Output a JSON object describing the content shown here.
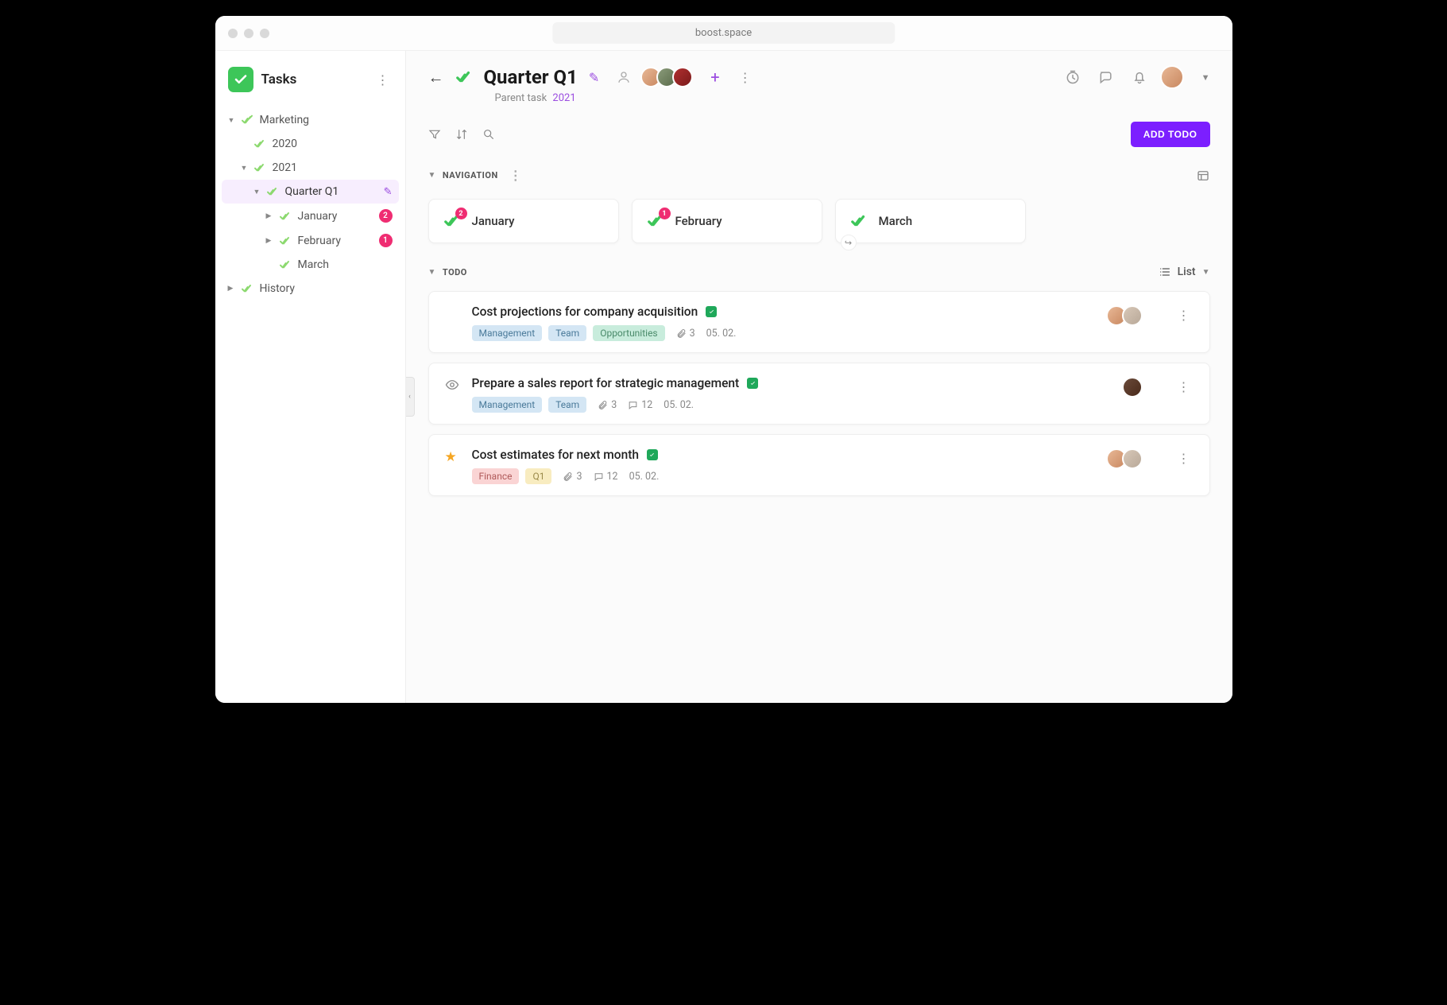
{
  "browser": {
    "url": "boost.space"
  },
  "sidebar": {
    "title": "Tasks",
    "tree": {
      "marketing": "Marketing",
      "y2020": "2020",
      "y2021": "2021",
      "quarter": "Quarter Q1",
      "months": [
        {
          "label": "January",
          "badge": "2"
        },
        {
          "label": "February",
          "badge": "1"
        },
        {
          "label": "March",
          "badge": ""
        }
      ],
      "history": "History"
    }
  },
  "header": {
    "title": "Quarter Q1",
    "breadcrumb_label": "Parent task",
    "breadcrumb_link": "2021",
    "add_todo": "ADD TODO"
  },
  "sections": {
    "navigation": "NAVIGATION",
    "todo": "TODO",
    "view_mode": "List"
  },
  "nav_cards": [
    {
      "label": "January",
      "badge": "2"
    },
    {
      "label": "February",
      "badge": "1"
    },
    {
      "label": "March",
      "badge": ""
    }
  ],
  "todos": [
    {
      "title": "Cost projections for company acquisition",
      "tags": [
        {
          "text": "Management",
          "cls": "tag-blue"
        },
        {
          "text": "Team",
          "cls": "tag-blue"
        },
        {
          "text": "Opportunities",
          "cls": "tag-teal"
        }
      ],
      "attachments": "3",
      "comments": "",
      "date": "05. 02.",
      "starred": false,
      "eye": false,
      "avatars": [
        "av1",
        "av5"
      ]
    },
    {
      "title": "Prepare a sales report for strategic management",
      "tags": [
        {
          "text": "Management",
          "cls": "tag-blue"
        },
        {
          "text": "Team",
          "cls": "tag-blue"
        }
      ],
      "attachments": "3",
      "comments": "12",
      "date": "05. 02.",
      "starred": false,
      "eye": true,
      "avatars": [
        "av4"
      ]
    },
    {
      "title": "Cost estimates for next month",
      "tags": [
        {
          "text": "Finance",
          "cls": "tag-red"
        },
        {
          "text": "Q1",
          "cls": "tag-yellow"
        }
      ],
      "attachments": "3",
      "comments": "12",
      "date": "05. 02.",
      "starred": true,
      "eye": false,
      "avatars": [
        "av1",
        "av5"
      ]
    }
  ]
}
